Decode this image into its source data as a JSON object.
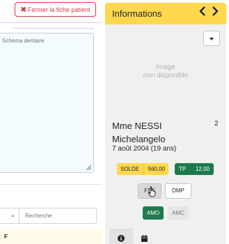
{
  "left_pane": {
    "close_button_label": "Fermer la fiche patient",
    "textarea_placeholder": "Schéma dentaire",
    "search_placeholder": "Recherche",
    "table_header_first_col": "F"
  },
  "panel": {
    "title": "Informations",
    "nav_prev": "<",
    "nav_next": ">",
    "photo_placeholder_line1": "Image",
    "photo_placeholder_line2": "non disponible",
    "patient_name_line1": "Mme NESSI",
    "patient_name_line2": "Michelangelo",
    "patient_birth": "7 août 2004 (19 ans)",
    "patient_count": "2",
    "solde_label": "SOLDE",
    "solde_value": "560,00",
    "tp_label": "TP",
    "tp_value": "12,00",
    "fse_label": "FSE",
    "dmp_label": "DMP",
    "amo_label": "AMO",
    "amc_label": "AMC"
  },
  "colors": {
    "header_yellow": "#ffd84d",
    "danger_red": "#dc3545",
    "success_green": "#1e7a4c",
    "panel_bg": "#f0f0f0"
  },
  "icons": {
    "close": "close-icon",
    "prev": "chevron-left-icon",
    "next": "chevron-right-icon",
    "menu": "caret-down-icon",
    "info": "info-icon",
    "calendar": "calendar-icon",
    "pointer": "hand-pointer-icon"
  }
}
